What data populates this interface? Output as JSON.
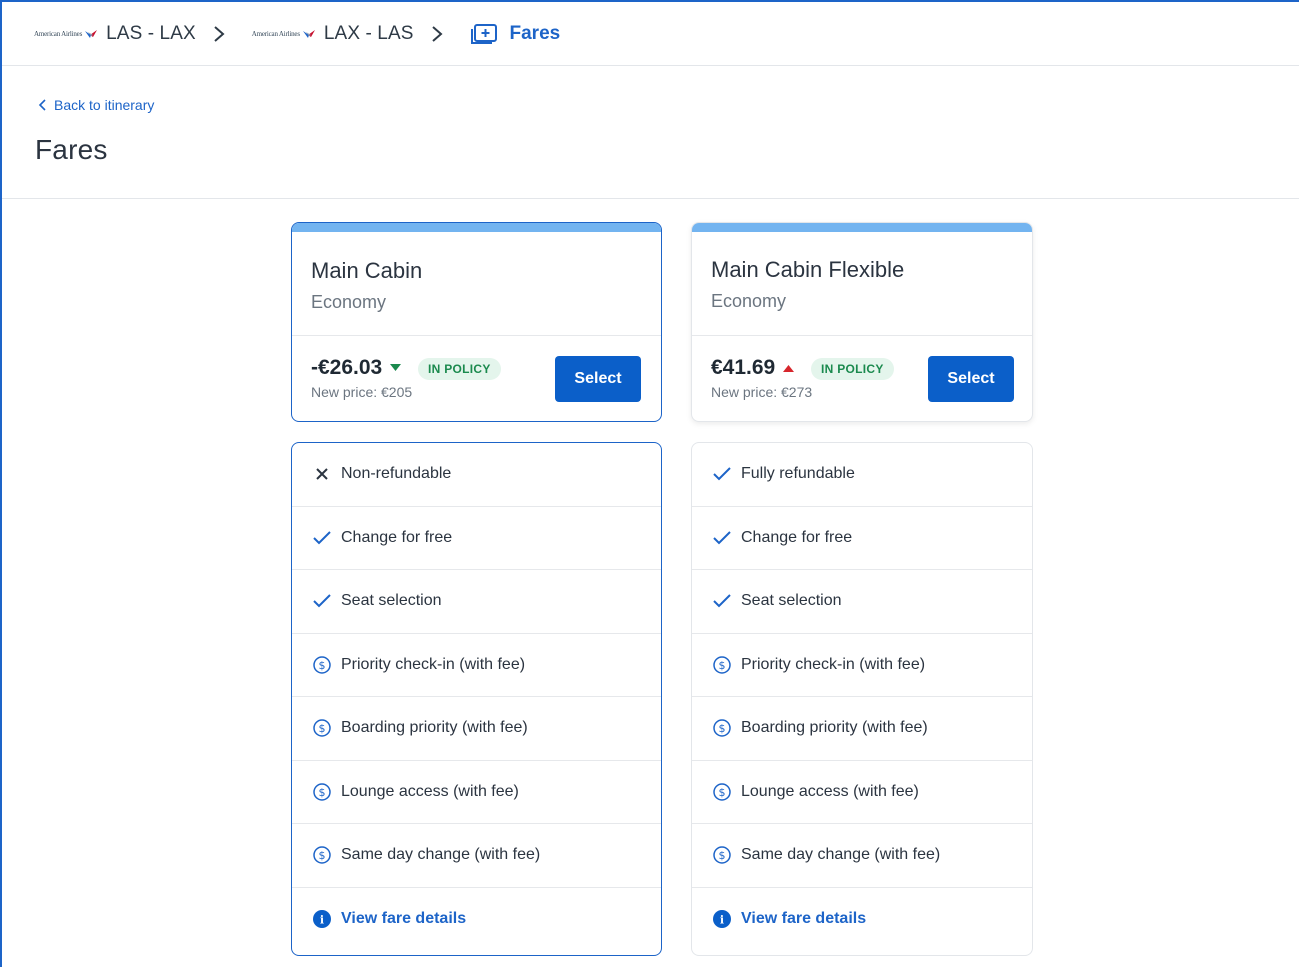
{
  "breadcrumb": {
    "airline_logo_text": "American Airlines",
    "legs": [
      "LAS - LAX",
      "LAX - LAS"
    ],
    "current": "Fares"
  },
  "header": {
    "back_label": "Back to itinerary",
    "title": "Fares"
  },
  "colors": {
    "primary": "#0b5fc9",
    "accent_bar": "#73b4f0",
    "policy_green": "#1b8a4e",
    "price_up_red": "#d7262c"
  },
  "fares": [
    {
      "name": "Main Cabin",
      "class": "Economy",
      "price_diff": "-€26.03",
      "trend": "down",
      "policy": "IN POLICY",
      "new_price": "New price: €205",
      "select_label": "Select",
      "features": [
        {
          "icon": "x-icon",
          "label": "Non-refundable"
        },
        {
          "icon": "check-icon",
          "label": "Change for free"
        },
        {
          "icon": "check-icon",
          "label": "Seat selection"
        },
        {
          "icon": "dollar-coin-icon",
          "label": "Priority check-in (with fee)"
        },
        {
          "icon": "dollar-coin-icon",
          "label": "Boarding priority (with fee)"
        },
        {
          "icon": "dollar-coin-icon",
          "label": "Lounge access (with fee)"
        },
        {
          "icon": "dollar-coin-icon",
          "label": "Same day change (with fee)"
        }
      ],
      "details_label": "View fare details"
    },
    {
      "name": "Main Cabin Flexible",
      "class": "Economy",
      "price_diff": "€41.69",
      "trend": "up",
      "policy": "IN POLICY",
      "new_price": "New price: €273",
      "select_label": "Select",
      "features": [
        {
          "icon": "check-icon",
          "label": "Fully refundable"
        },
        {
          "icon": "check-icon",
          "label": "Change for free"
        },
        {
          "icon": "check-icon",
          "label": "Seat selection"
        },
        {
          "icon": "dollar-coin-icon",
          "label": "Priority check-in (with fee)"
        },
        {
          "icon": "dollar-coin-icon",
          "label": "Boarding priority (with fee)"
        },
        {
          "icon": "dollar-coin-icon",
          "label": "Lounge access (with fee)"
        },
        {
          "icon": "dollar-coin-icon",
          "label": "Same day change (with fee)"
        }
      ],
      "details_label": "View fare details"
    }
  ]
}
